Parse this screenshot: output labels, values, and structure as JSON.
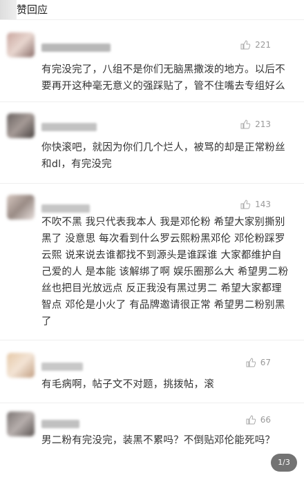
{
  "header": {
    "title": "赞回应"
  },
  "comments": [
    {
      "likes": "221",
      "text": "有完没完了，八组不是你们无脑黑撒泼的地方。以后不要再开这种毫无意义的强踩贴了，管不住嘴去专组好么"
    },
    {
      "likes": "213",
      "text": "你快滚吧，就因为你们几个烂人，被骂的却是正常粉丝和dl，有完没完"
    },
    {
      "likes": "143",
      "text": "不吹不黑 我只代表我本人 我是邓伦粉  希望大家别撕别黑了 没意思 每次看到什么罗云熙粉黑邓伦 邓伦粉踩罗云熙 说来说去谁都找不到源头是谁踩谁 大家都维护自己爱的人 是本能 该解绑了啊 娱乐圈那么大 希望男二粉丝也把目光放远点 反正我没有黑过男二 希望大家都理智点 邓伦是小火了 有品牌邀请很正常 希望男二粉别黑了"
    },
    {
      "likes": "67",
      "text": "有毛病啊，帖子文不对题，挑拨帖，滚"
    },
    {
      "likes": "66",
      "text": "男二粉有完没完，装黑不累吗？不倒贴邓伦能死吗？"
    }
  ],
  "page_indicator": "1/3",
  "colors": {
    "text": "#333333",
    "likes": "#999999",
    "badge_bg": "rgba(0,0,0,0.55)"
  },
  "icons": {
    "like": "thumbs-up-icon"
  }
}
